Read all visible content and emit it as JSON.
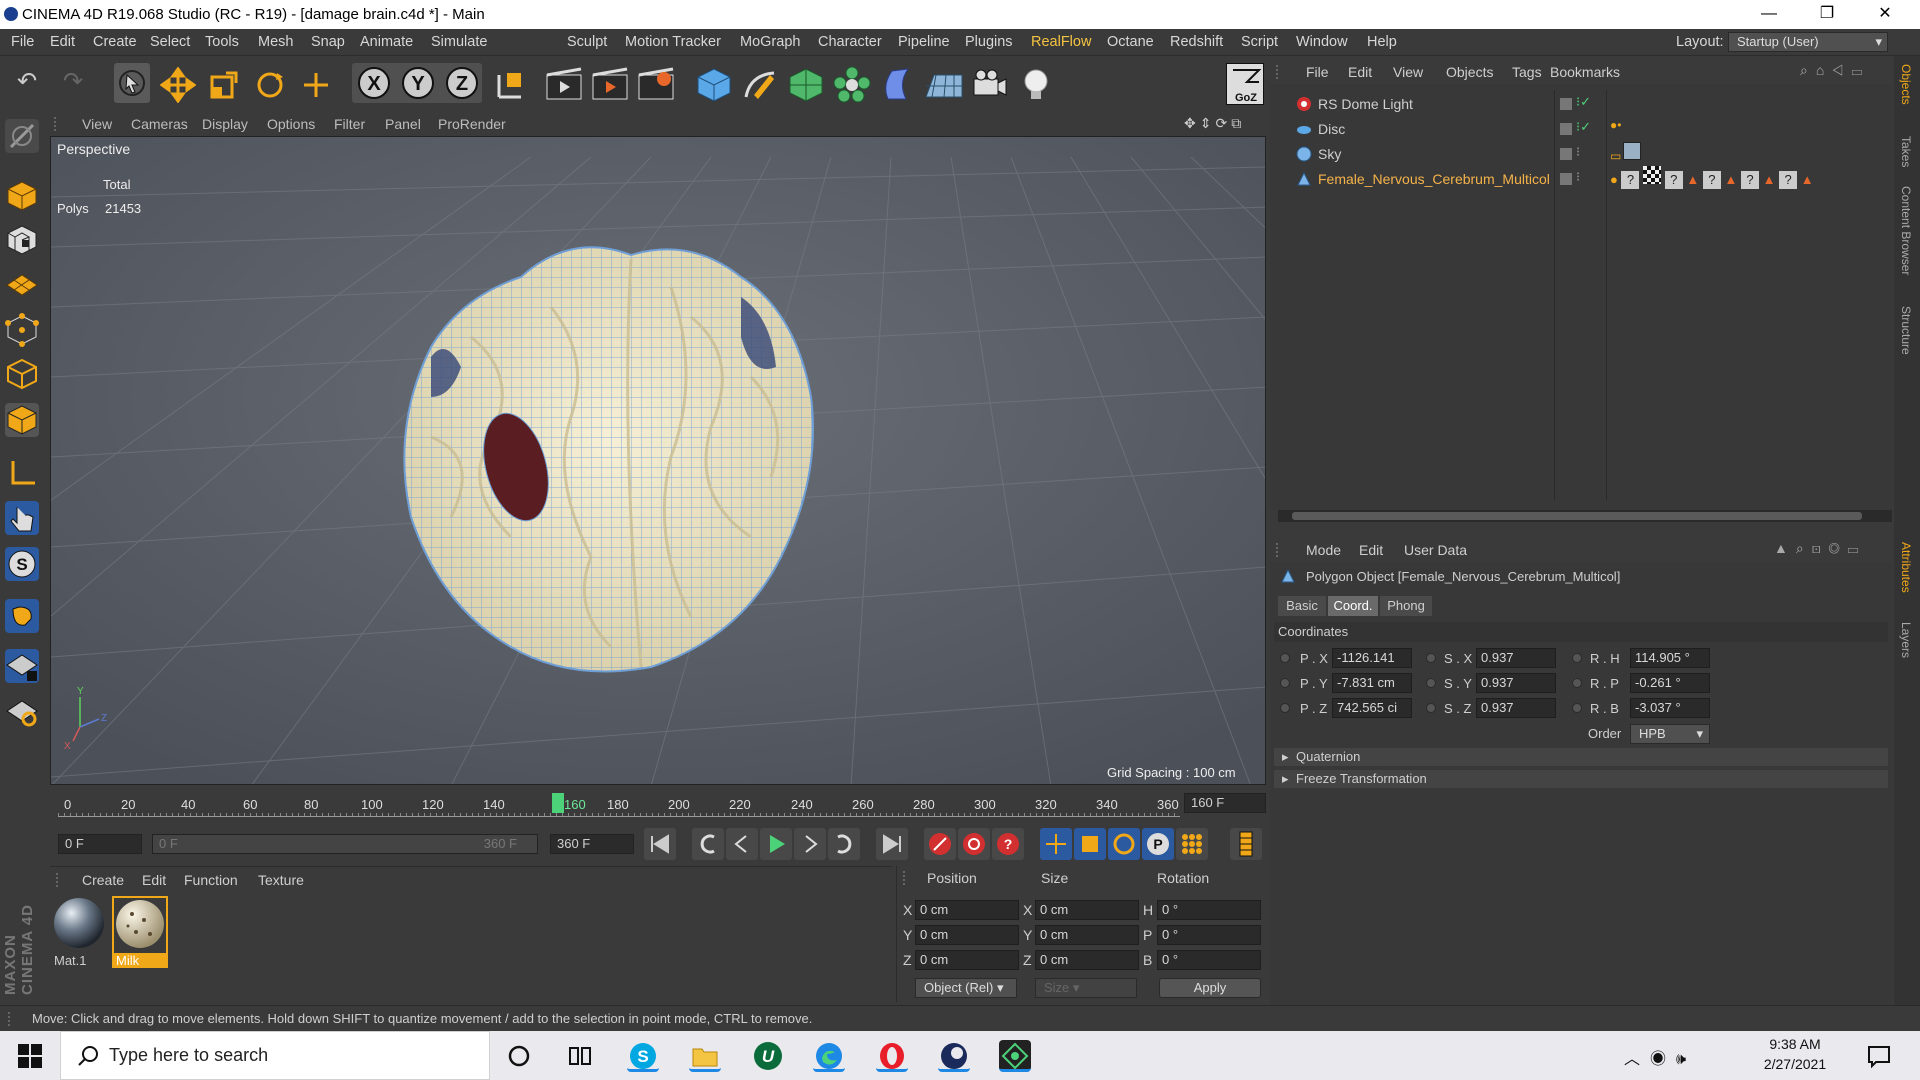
{
  "window": {
    "title": "CINEMA 4D R19.068 Studio (RC - R19) - [damage brain.c4d *] - Main",
    "minimize": "—",
    "maximize": "❐",
    "close": "✕"
  },
  "menu": {
    "items": [
      "File",
      "Edit",
      "Create",
      "Select",
      "Tools",
      "Mesh",
      "Snap",
      "Animate",
      "Simulate",
      "Sculpt",
      "Motion Tracker",
      "MoGraph",
      "Character",
      "Pipeline",
      "Plugins",
      "RealFlow",
      "Octane",
      "Redshift",
      "Script",
      "Window",
      "Help"
    ],
    "layout_label": "Layout:",
    "layout_value": "Startup (User)"
  },
  "viewport": {
    "menu": [
      "View",
      "Cameras",
      "Display",
      "Options",
      "Filter",
      "Panel",
      "ProRender"
    ],
    "name": "Perspective",
    "stats_header": "Total",
    "polys_label": "Polys",
    "polys_value": "21453",
    "grid_spacing": "Grid Spacing : 100 cm"
  },
  "timeline": {
    "ticks": [
      "0",
      "20",
      "40",
      "60",
      "80",
      "100",
      "120",
      "140",
      "160",
      "180",
      "200",
      "220",
      "240",
      "260",
      "280",
      "300",
      "320",
      "340",
      "360"
    ],
    "current_frame": "160",
    "end_display": "160 F"
  },
  "transport": {
    "start_field": "0 F",
    "range_start": "0 F",
    "range_end": "360 F",
    "end_field": "360 F"
  },
  "material_manager": {
    "menu": [
      "Create",
      "Edit",
      "Function",
      "Texture"
    ],
    "materials": [
      {
        "name": "Mat.1"
      },
      {
        "name": "Milk"
      }
    ]
  },
  "coordinates_manager": {
    "headers": [
      "Position",
      "Size",
      "Rotation"
    ],
    "rows": [
      {
        "axis": "X",
        "pos": "0 cm",
        "size_axis": "X",
        "size": "0 cm",
        "rot_axis": "H",
        "rot": "0 °"
      },
      {
        "axis": "Y",
        "pos": "0 cm",
        "size_axis": "Y",
        "size": "0 cm",
        "rot_axis": "P",
        "rot": "0 °"
      },
      {
        "axis": "Z",
        "pos": "0 cm",
        "size_axis": "Z",
        "size": "0 cm",
        "rot_axis": "B",
        "rot": "0 °"
      }
    ],
    "mode": "Object (Rel)",
    "size_mode": "Size",
    "apply": "Apply"
  },
  "object_manager": {
    "menu": [
      "File",
      "Edit",
      "View",
      "Objects",
      "Tags",
      "Bookmarks"
    ],
    "objects": [
      {
        "name": "RS Dome Light",
        "color": "#cfcfcf"
      },
      {
        "name": "Disc",
        "color": "#cfcfcf"
      },
      {
        "name": "Sky",
        "color": "#cfcfcf"
      },
      {
        "name": "Female_Nervous_Cerebrum_Multicol",
        "color": "#f5b34a"
      }
    ]
  },
  "attribute_manager": {
    "menu": [
      "Mode",
      "Edit",
      "User Data"
    ],
    "object_title": "Polygon Object [Female_Nervous_Cerebrum_Multicol]",
    "tabs": [
      "Basic",
      "Coord.",
      "Phong"
    ],
    "active_tab": "Coord.",
    "section": "Coordinates",
    "rows": [
      {
        "pl": "P . X",
        "pv": "-1126.141",
        "sl": "S . X",
        "sv": "0.937",
        "rl": "R . H",
        "rv": "114.905 °"
      },
      {
        "pl": "P . Y",
        "pv": "-7.831 cm",
        "sl": "S . Y",
        "sv": "0.937",
        "rl": "R . P",
        "rv": "-0.261 °"
      },
      {
        "pl": "P . Z",
        "pv": "742.565 ci",
        "sl": "S . Z",
        "sv": "0.937",
        "rl": "R . B",
        "rv": "-3.037 °"
      }
    ],
    "order_label": "Order",
    "order_value": "HPB",
    "groups": [
      "Quaternion",
      "Freeze Transformation"
    ]
  },
  "side_tabs": [
    "Objects",
    "Takes",
    "Content Browser",
    "Structure",
    "Attributes",
    "Layers"
  ],
  "status": "Move: Click and drag to move elements. Hold down SHIFT to quantize movement / add to the selection in point mode, CTRL to remove.",
  "brand": "MAXON CINEMA 4D",
  "taskbar": {
    "search_placeholder": "Type here to search",
    "time": "9:38 AM",
    "date": "2/27/2021"
  },
  "colors": {
    "accent_realflow": "#f5c342",
    "selected_object": "#f5b34a",
    "viewport_bg": "#5b6068",
    "brain_fill": "#efe6c8",
    "brain_wire": "#6f9fd6"
  }
}
